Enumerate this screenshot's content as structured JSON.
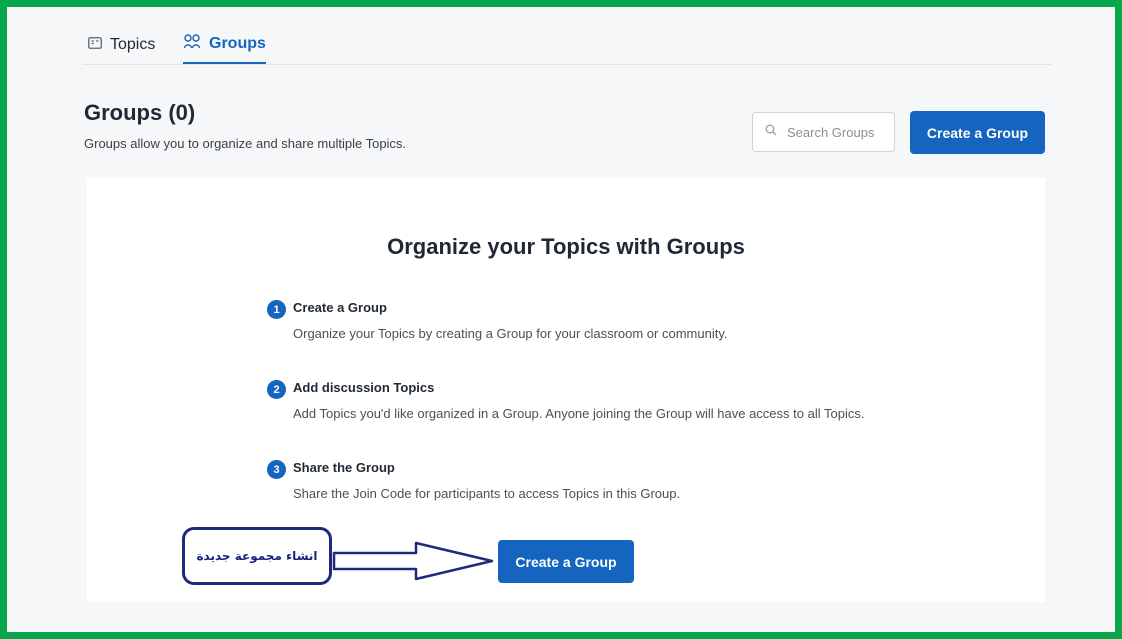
{
  "tabs": [
    {
      "label": "Topics",
      "icon": "topics-icon",
      "active": false
    },
    {
      "label": "Groups",
      "icon": "groups-icon",
      "active": true
    }
  ],
  "header": {
    "title": "Groups (0)",
    "subtitle": "Groups allow you to organize and share multiple Topics.",
    "search_placeholder": "Search Groups",
    "create_button_label": "Create a Group"
  },
  "card": {
    "title": "Organize your Topics with Groups",
    "steps": [
      {
        "number": "1",
        "title": "Create a Group",
        "description": "Organize your Topics by creating a Group for your classroom or community."
      },
      {
        "number": "2",
        "title": "Add discussion Topics",
        "description": "Add Topics you'd like organized in a Group. Anyone joining the Group will have access to all Topics."
      },
      {
        "number": "3",
        "title": "Share the Group",
        "description": "Share the Join Code for participants to access Topics in this Group."
      }
    ],
    "create_button_label": "Create a Group"
  },
  "annotation": {
    "text": "انشاء مجموعة جديدة",
    "arrow_icon": "arrow-right-icon"
  },
  "colors": {
    "accent": "#1565c0",
    "frame_border": "#0aa64c",
    "annotation": "#1f2a7a"
  }
}
